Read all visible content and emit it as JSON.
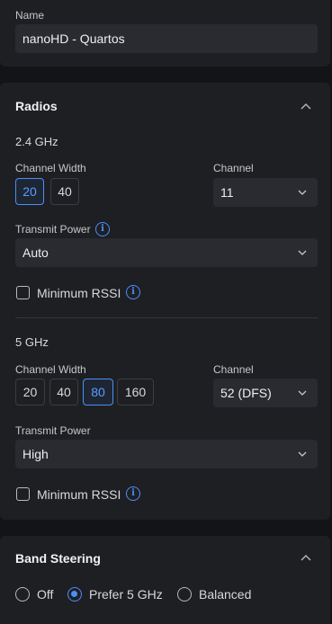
{
  "name_card": {
    "label": "Name",
    "value": "nanoHD - Quartos"
  },
  "radios": {
    "title": "Radios",
    "collapse_icon": "chevron-up-icon",
    "band_24": {
      "heading": "2.4 GHz",
      "channel_width_label": "Channel Width",
      "widths": [
        "20",
        "40"
      ],
      "selected_width": "20",
      "channel_label": "Channel",
      "channel_value": "11",
      "transmit_power_label": "Transmit Power",
      "transmit_power_value": "Auto",
      "min_rssi_label": "Minimum RSSI",
      "min_rssi_checked": false
    },
    "band_5": {
      "heading": "5 GHz",
      "channel_width_label": "Channel Width",
      "widths": [
        "20",
        "40",
        "80",
        "160"
      ],
      "selected_width": "80",
      "channel_label": "Channel",
      "channel_value": "52 (DFS)",
      "transmit_power_label": "Transmit Power",
      "transmit_power_value": "High",
      "min_rssi_label": "Minimum RSSI",
      "min_rssi_checked": false
    }
  },
  "band_steering": {
    "title": "Band Steering",
    "collapse_icon": "chevron-up-icon",
    "options": [
      "Off",
      "Prefer 5 GHz",
      "Balanced"
    ],
    "selected": "Prefer 5 GHz"
  },
  "colors": {
    "accent": "#4a8ff7",
    "card_bg": "#1e1f23",
    "page_bg": "#131417"
  }
}
